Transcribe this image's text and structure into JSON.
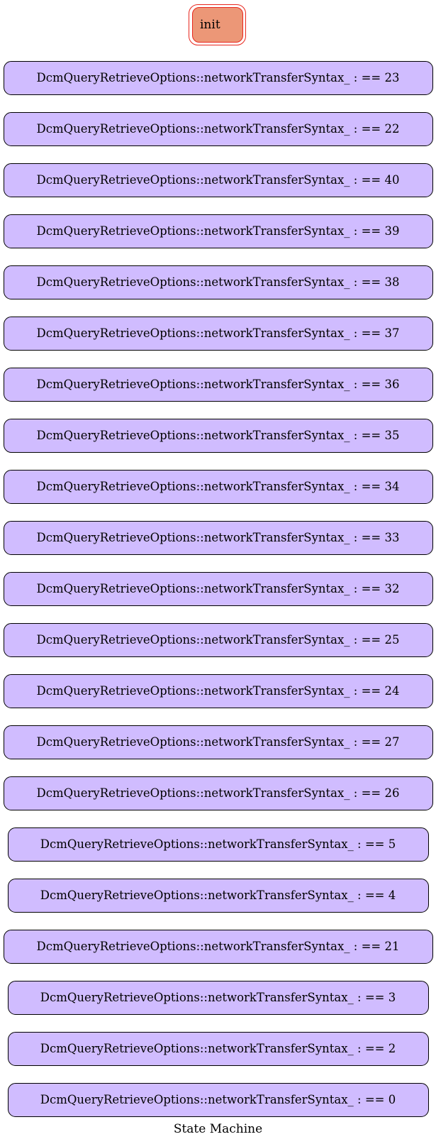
{
  "diagram": {
    "init_label": "init",
    "caption": "State Machine",
    "colors": {
      "init_fill": "#ec9777",
      "init_border": "#e8271e",
      "state_fill": "#d0bcff",
      "state_border": "#000000"
    },
    "states": [
      "DcmQueryRetrieveOptions::networkTransferSyntax_ : == 23",
      "DcmQueryRetrieveOptions::networkTransferSyntax_ : == 22",
      "DcmQueryRetrieveOptions::networkTransferSyntax_ : == 40",
      "DcmQueryRetrieveOptions::networkTransferSyntax_ : == 39",
      "DcmQueryRetrieveOptions::networkTransferSyntax_ : == 38",
      "DcmQueryRetrieveOptions::networkTransferSyntax_ : == 37",
      "DcmQueryRetrieveOptions::networkTransferSyntax_ : == 36",
      "DcmQueryRetrieveOptions::networkTransferSyntax_ : == 35",
      "DcmQueryRetrieveOptions::networkTransferSyntax_ : == 34",
      "DcmQueryRetrieveOptions::networkTransferSyntax_ : == 33",
      "DcmQueryRetrieveOptions::networkTransferSyntax_ : == 32",
      "DcmQueryRetrieveOptions::networkTransferSyntax_ : == 25",
      "DcmQueryRetrieveOptions::networkTransferSyntax_ : == 24",
      "DcmQueryRetrieveOptions::networkTransferSyntax_ : == 27",
      "DcmQueryRetrieveOptions::networkTransferSyntax_ : == 26",
      "DcmQueryRetrieveOptions::networkTransferSyntax_ : == 5",
      "DcmQueryRetrieveOptions::networkTransferSyntax_ : == 4",
      "DcmQueryRetrieveOptions::networkTransferSyntax_ : == 21",
      "DcmQueryRetrieveOptions::networkTransferSyntax_ : == 3",
      "DcmQueryRetrieveOptions::networkTransferSyntax_ : == 2",
      "DcmQueryRetrieveOptions::networkTransferSyntax_ : == 0"
    ]
  }
}
